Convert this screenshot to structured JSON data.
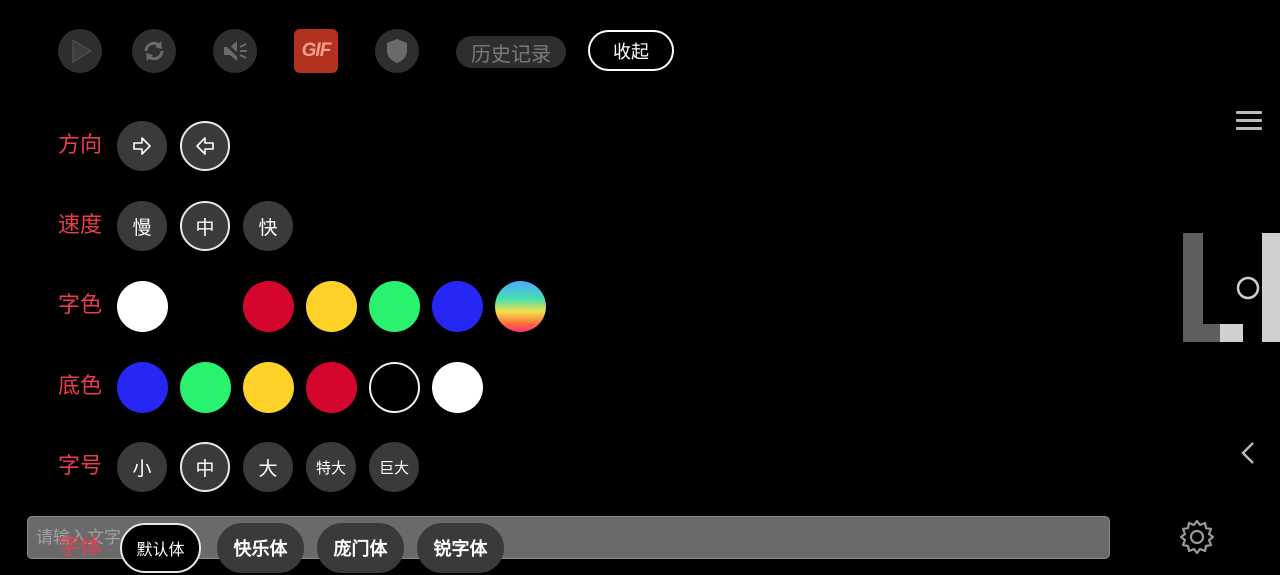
{
  "toolbar": {
    "play_icon": "play-icon",
    "refresh_icon": "refresh-icon",
    "mute_icon": "mute-icon",
    "gif_label": "GIF",
    "shield_icon": "shield-icon",
    "history_label": "历史记录",
    "collapse_label": "收起"
  },
  "direction": {
    "label": "方向",
    "options": [
      "right-arrow-icon",
      "left-arrow-icon"
    ],
    "selected_index": 1
  },
  "speed": {
    "label": "速度",
    "options": [
      "慢",
      "中",
      "快"
    ],
    "selected_index": 1
  },
  "text_color": {
    "label": "字色",
    "colors": [
      "#ffffff",
      "#000000",
      "#d4062e",
      "#ffd22a",
      "#29f26f",
      "#2626f5",
      "gradient"
    ]
  },
  "bg_color": {
    "label": "底色",
    "colors": [
      "#2626f5",
      "#29f26f",
      "#ffd22a",
      "#d4062e",
      "#000000",
      "#ffffff"
    ],
    "selected_index": 4
  },
  "font_size": {
    "label": "字号",
    "options": [
      "小",
      "中",
      "大",
      "特大",
      "巨大"
    ],
    "selected_index": 1
  },
  "input": {
    "placeholder": "请输入文字"
  },
  "font_family": {
    "label": "字体",
    "options": [
      "默认体",
      "快乐体",
      "庞门体",
      "锐字体"
    ],
    "selected_index": 0
  },
  "side": {
    "menu_icon": "hamburger-menu-icon",
    "back_icon": "chevron-left-icon",
    "settings_icon": "gear-icon"
  }
}
